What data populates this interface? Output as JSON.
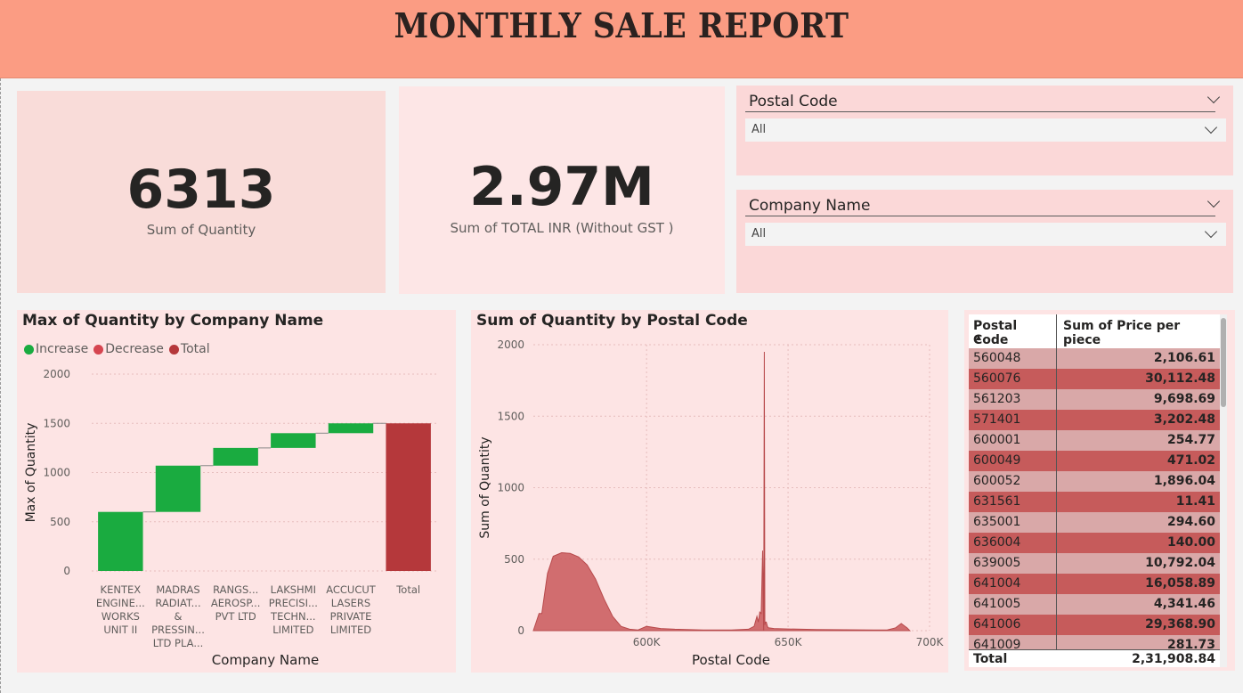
{
  "header": {
    "title": "MONTHLY SALE REPORT"
  },
  "kpis": {
    "quantity": {
      "value": "6313",
      "label": "Sum of Quantity"
    },
    "total_inr": {
      "value": "2.97M",
      "label": "Sum of TOTAL INR (Without GST )"
    }
  },
  "slicers": {
    "postal_code": {
      "title": "Postal Code",
      "selected": "All"
    },
    "company_name": {
      "title": "Company Name",
      "selected": "All"
    }
  },
  "waterfall": {
    "title": "Max of Quantity by Company Name",
    "legend": [
      {
        "label": "Increase",
        "color": "#1aab40"
      },
      {
        "label": "Decrease",
        "color": "#d64550"
      },
      {
        "label": "Total",
        "color": "#b5383b"
      }
    ]
  },
  "area": {
    "title": "Sum of Quantity by Postal Code"
  },
  "table": {
    "headers": {
      "postal_code": "Postal Code",
      "price": "Sum of Price per piece"
    },
    "sort_icon": "sort-ascending-icon",
    "rows": [
      {
        "code": "560048",
        "price": "2,106.61"
      },
      {
        "code": "560076",
        "price": "30,112.48"
      },
      {
        "code": "561203",
        "price": "9,698.69"
      },
      {
        "code": "571401",
        "price": "3,202.48"
      },
      {
        "code": "600001",
        "price": "254.77"
      },
      {
        "code": "600049",
        "price": "471.02"
      },
      {
        "code": "600052",
        "price": "1,896.04"
      },
      {
        "code": "631561",
        "price": "11.41"
      },
      {
        "code": "635001",
        "price": "294.60"
      },
      {
        "code": "636004",
        "price": "140.00"
      },
      {
        "code": "639005",
        "price": "10,792.04"
      },
      {
        "code": "641004",
        "price": "16,058.89"
      },
      {
        "code": "641005",
        "price": "4,341.46"
      },
      {
        "code": "641006",
        "price": "29,368.90"
      },
      {
        "code": "641009",
        "price": "281.73"
      }
    ],
    "total_label": "Total",
    "total_value": "2,31,908.84",
    "row_colors": [
      "#d9a8a8",
      "#c65b5b"
    ]
  },
  "chart_data": [
    {
      "type": "waterfall",
      "title": "Max of Quantity by Company Name",
      "xlabel": "Company Name",
      "ylabel": "Max of Quantity",
      "ylim": [
        0,
        2000
      ],
      "yticks": [
        0,
        500,
        1000,
        1500,
        2000
      ],
      "categories": [
        [
          "KENTEX",
          "ENGINE...",
          "WORKS",
          "UNIT II"
        ],
        [
          "MADRAS",
          "RADIAT...",
          "&",
          "PRESSIN...",
          "LTD PLA..."
        ],
        [
          "RANGS...",
          "AEROSP...",
          "PVT LTD"
        ],
        [
          "LAKSHMI",
          "PRECISI...",
          "TECHN...",
          "LIMITED"
        ],
        [
          "ACCUCUT",
          "LASERS",
          "PRIVATE",
          "LIMITED"
        ],
        [
          "Total"
        ]
      ],
      "values": [
        600,
        470,
        180,
        150,
        100,
        1500
      ],
      "kinds": [
        "increase",
        "increase",
        "increase",
        "increase",
        "increase",
        "total"
      ],
      "grid": true
    },
    {
      "type": "area",
      "title": "Sum of Quantity by Postal Code",
      "xlabel": "Postal Code",
      "ylabel": "Sum of Quantity",
      "xlim": [
        560000,
        700000
      ],
      "ylim": [
        0,
        2000
      ],
      "xticks": [
        600000,
        650000,
        700000
      ],
      "xtick_labels": [
        "600K",
        "650K",
        "700K"
      ],
      "yticks": [
        0,
        500,
        1000,
        1500,
        2000
      ],
      "x": [
        560000,
        561000,
        562000,
        563000,
        565000,
        567000,
        570000,
        573000,
        576000,
        579000,
        582000,
        585000,
        588000,
        591000,
        594000,
        597000,
        600000,
        605000,
        610000,
        620000,
        630000,
        636000,
        638000,
        639000,
        639500,
        640000,
        640500,
        641000,
        641400,
        641600,
        641800,
        642000,
        642300,
        642700,
        643000,
        645000,
        650000,
        660000,
        670000,
        680000,
        685000,
        688000,
        690000,
        692000,
        693000
      ],
      "y": [
        0,
        60,
        120,
        120,
        400,
        520,
        545,
        540,
        515,
        460,
        360,
        220,
        100,
        30,
        10,
        5,
        30,
        15,
        10,
        5,
        5,
        10,
        30,
        100,
        60,
        130,
        120,
        560,
        0,
        1950,
        40,
        60,
        60,
        30,
        20,
        15,
        12,
        8,
        6,
        5,
        5,
        20,
        50,
        20,
        0
      ],
      "color": "#c9585a",
      "grid": true
    }
  ]
}
